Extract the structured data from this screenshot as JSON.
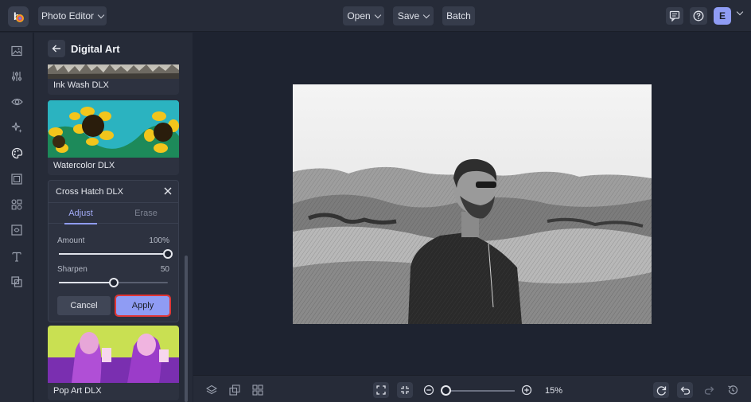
{
  "topbar": {
    "app_menu_label": "Photo Editor",
    "open_label": "Open",
    "save_label": "Save",
    "batch_label": "Batch",
    "avatar_initial": "E"
  },
  "rail": {
    "icons": [
      "image-icon",
      "adjust-sliders-icon",
      "eye-icon",
      "sparkle-icon",
      "palette-icon",
      "frame-icon",
      "graphics-icon",
      "texture-icon",
      "text-icon",
      "overlay-icon"
    ]
  },
  "panel": {
    "title": "Digital Art",
    "effects": [
      {
        "label": "Ink Wash DLX"
      },
      {
        "label": "Watercolor DLX"
      },
      {
        "label": "Pop Art DLX"
      }
    ],
    "active_effect": {
      "title": "Cross Hatch DLX",
      "tabs": [
        {
          "label": "Adjust",
          "active": true
        },
        {
          "label": "Erase",
          "active": false
        }
      ],
      "sliders": [
        {
          "label": "Amount",
          "value_text": "100%",
          "level": 1.0
        },
        {
          "label": "Sharpen",
          "value_text": "50",
          "level": 0.5
        }
      ],
      "cancel_label": "Cancel",
      "apply_label": "Apply"
    }
  },
  "bottombar": {
    "zoom_text": "15%",
    "zoom_level": 0.0
  },
  "colors": {
    "accent": "#8f9cf4",
    "apply_highlight": "#e03535",
    "background": "#1e2330",
    "panel": "#262b38"
  }
}
